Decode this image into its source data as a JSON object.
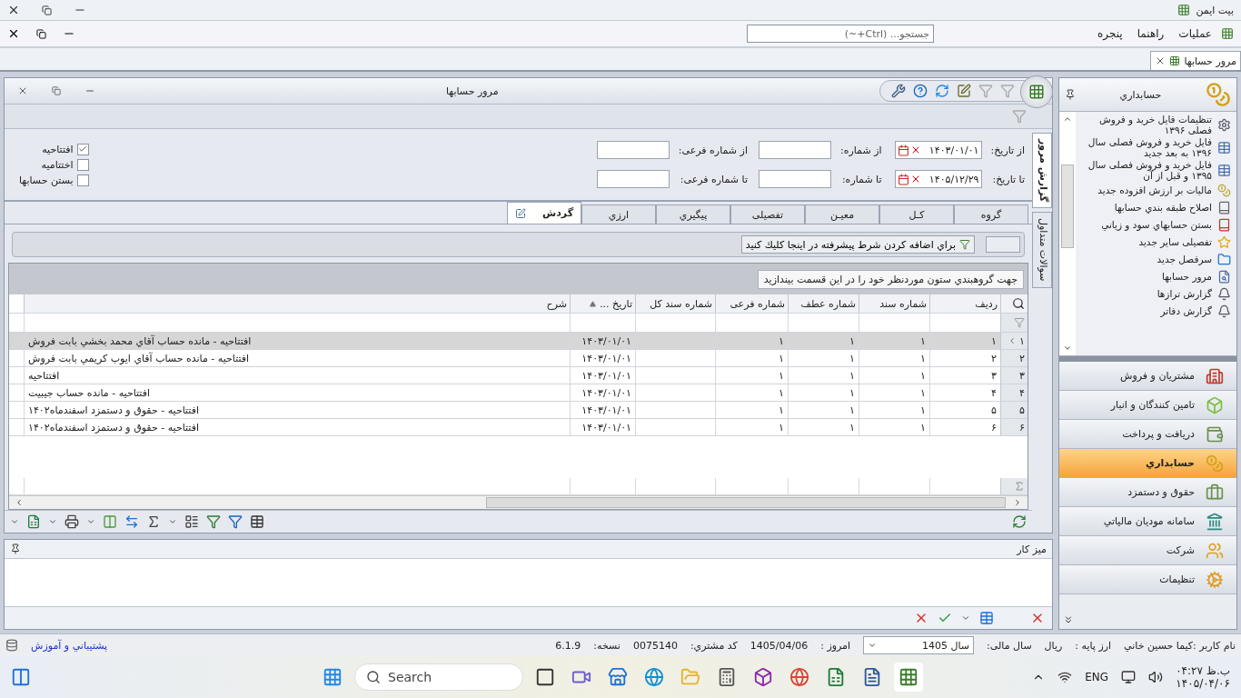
{
  "app_title": "بيت ايمن",
  "menu": [
    {
      "label": "عمليات"
    },
    {
      "label": "راهنما"
    },
    {
      "label": "پنجره"
    }
  ],
  "search": {
    "placeholder": "جستجو... (Ctrl+~)"
  },
  "doc_tabs": [
    {
      "label": "مرور حسابها",
      "selected": true
    }
  ],
  "report_window": {
    "title": "مرور حسابها",
    "filters": {
      "from_date_label": "از تاريخ:",
      "from_date": "۱۴۰۳/۰۱/۰۱",
      "to_date_label": "تا تاريخ:",
      "to_date": "۱۴۰۵/۱۲/۲۹",
      "from_number_label": "از شماره:",
      "to_number_label": "تا شماره:",
      "from_sub_label": "از شماره فرعی:",
      "to_sub_label": "تا شماره فرعی:"
    },
    "options": [
      {
        "label": "افتتاحيه",
        "checked": true
      },
      {
        "label": "اختتاميه",
        "checked": false
      },
      {
        "label": "بستن حسابها",
        "checked": false
      }
    ],
    "side_tabs": [
      {
        "label": "گزارش مرور",
        "selected": true
      },
      {
        "label": "سوالات متداول",
        "selected": false
      }
    ],
    "tabs": [
      {
        "label": "گروه",
        "selected": false
      },
      {
        "label": "کـل",
        "selected": false
      },
      {
        "label": "معيـن",
        "selected": false
      },
      {
        "label": "تفصيلی",
        "selected": false
      },
      {
        "label": "پيگيري",
        "selected": false
      },
      {
        "label": "ارزي",
        "selected": false
      },
      {
        "label": "گردش",
        "selected": true
      }
    ],
    "condition_button": "براي اضافه كردن شرط پيشرفته در اينجا كليك كنيد",
    "group_hint": "جهت گروهبندي ستون موردنظر خود را در این قسمت بيندازيد",
    "table": {
      "columns": [
        "رديف",
        "شماره سند",
        "شماره عطف",
        "شماره فرعی",
        "شماره سند كل",
        "تاريخ ...",
        "شرح"
      ],
      "rows": [
        {
          "indicator": "۱",
          "selected": true,
          "cells": [
            "۱",
            "۱",
            "۱",
            "۱",
            "",
            "۱۴۰۳/۰۱/۰۱",
            "افتتاحيه - مانده حساب آقاي محمد بخشي بابت فروش"
          ]
        },
        {
          "indicator": "۲",
          "selected": false,
          "cells": [
            "۲",
            "۱",
            "۱",
            "۱",
            "",
            "۱۴۰۳/۰۱/۰۱",
            "افتتاحيه - مانده حساب آقاي ايوب كريمي بابت فروش"
          ]
        },
        {
          "indicator": "۳",
          "selected": false,
          "cells": [
            "۳",
            "۱",
            "۱",
            "۱",
            "",
            "۱۴۰۳/۰۱/۰۱",
            "افتتاحيه"
          ]
        },
        {
          "indicator": "۴",
          "selected": false,
          "cells": [
            "۴",
            "۱",
            "۱",
            "۱",
            "",
            "۱۴۰۳/۰۱/۰۱",
            "افتتاحيه - مانده حساب جيبيت"
          ]
        },
        {
          "indicator": "۵",
          "selected": false,
          "cells": [
            "۵",
            "۱",
            "۱",
            "۱",
            "",
            "۱۴۰۳/۰۱/۰۱",
            "افتتاحيه - حقوق و دستمزد اسفندماه۱۴۰۲"
          ]
        },
        {
          "indicator": "۶",
          "selected": false,
          "cells": [
            "۶",
            "۱",
            "۱",
            "۱",
            "",
            "۱۴۰۳/۰۱/۰۱",
            "افتتاحيه - حقوق و دستمزد اسفندماه۱۴۰۲"
          ]
        }
      ]
    }
  },
  "workspace": {
    "title": "ميز كار"
  },
  "sidebar": {
    "title": "حسابداري",
    "items": [
      {
        "label": "تنظيمات فايل خريد و فروش فصلی ۱۳۹۶"
      },
      {
        "label": "فايل خريد و فروش فصلی سال ۱۳۹۶ به بعد جديد"
      },
      {
        "label": "فايل خريد و فروش فصلی سال ۱۳۹۵ و قبل از آن"
      },
      {
        "label": "ماليات بر ارزش افزوده جديد"
      },
      {
        "label": "اصلاح طبقه بندي حسابها"
      },
      {
        "label": "بستن حسابهاي سود و زياني"
      },
      {
        "label": "تفصيلی ساير جديد"
      },
      {
        "label": "سرفصل جديد"
      },
      {
        "label": "مرور حسابها"
      },
      {
        "label": "گزارش ترازها"
      },
      {
        "label": "گزارش دفاتر"
      }
    ],
    "modules": [
      {
        "label": "مشتريان و فروش",
        "selected": false
      },
      {
        "label": "تامين كنندگان و انبار",
        "selected": false
      },
      {
        "label": "دريافت و پرداخت",
        "selected": false
      },
      {
        "label": "حسابداري",
        "selected": true
      },
      {
        "label": "حقوق و دستمزد",
        "selected": false
      },
      {
        "label": "سامانه موديان مالياتي",
        "selected": false
      },
      {
        "label": "شركت",
        "selected": false
      },
      {
        "label": "تنظيمات",
        "selected": false
      }
    ]
  },
  "status": {
    "user": "نام كاربر :كيما حسين خاني",
    "currency_label": "ارز پايه :",
    "currency": "ريال",
    "year_label": "سال مالی:",
    "year": "سال 1405",
    "today_label": "امروز :",
    "today": "1405/04/06",
    "customer_label": "كد مشتري:",
    "customer": "0075140",
    "version_label": "نسخه:",
    "version": "6.1.9",
    "support_link": "پشتيباني و آموزش"
  },
  "taskbar": {
    "search_placeholder": "Search",
    "language": "ENG",
    "time": "۰۴:۲۷ ب.ظ",
    "date": "۱۴۰۵/۰۴/۰۶"
  }
}
